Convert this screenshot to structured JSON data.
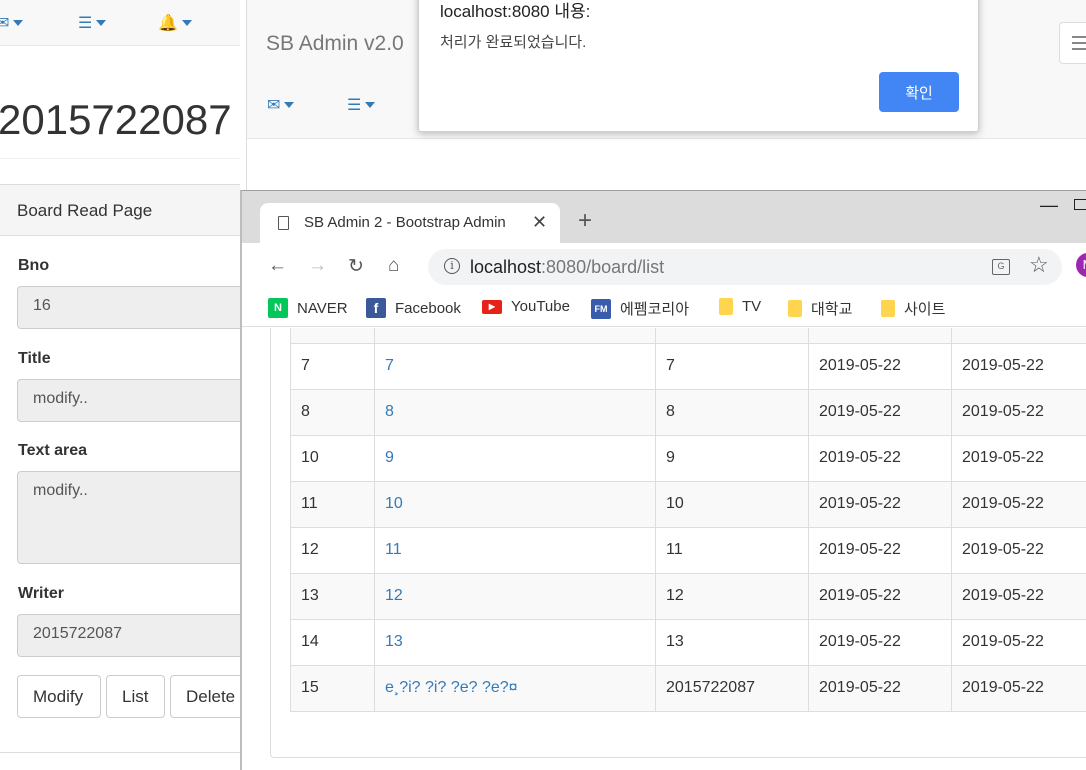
{
  "left_window": {
    "big_number": "2015722087",
    "panel_heading": "Board Read Page",
    "fields": [
      {
        "label": "Bno",
        "value": "16"
      },
      {
        "label": "Title",
        "value": "modify.."
      },
      {
        "label": "Text area",
        "value": "modify.."
      },
      {
        "label": "Writer",
        "value": "2015722087"
      }
    ],
    "buttons": [
      "Modify",
      "List",
      "Delete"
    ]
  },
  "middle_window": {
    "brand": "SB Admin v2.0"
  },
  "alert": {
    "title": "localhost:8080 내용:",
    "message": "처리가 완료되었습니다.",
    "ok_label": "확인"
  },
  "browser": {
    "tab_title": "SB Admin 2 - Bootstrap Admin",
    "url_host": "localhost",
    "url_rest": ":8080/board/list",
    "profile_initial": "M",
    "bookmarks": [
      {
        "label": "NAVER",
        "icon": "naver-icon",
        "color": "#03c75a",
        "glyph": "N"
      },
      {
        "label": "Facebook",
        "icon": "facebook-icon",
        "color": "#3b5998",
        "glyph": "f"
      },
      {
        "label": "YouTube",
        "icon": "youtube-icon",
        "color": "#e62117",
        "glyph": "▶"
      },
      {
        "label": "에펨코리아",
        "icon": "fmkorea-icon",
        "color": "#3a5cad",
        "glyph": "FM"
      },
      {
        "label": "TV",
        "icon": "folder-icon"
      },
      {
        "label": "대학교",
        "icon": "folder-icon"
      },
      {
        "label": "사이트",
        "icon": "folder-icon"
      }
    ]
  },
  "board_table": {
    "rows": [
      {
        "bno": "7",
        "title": "7",
        "writer": "7",
        "regdate": "2019-05-22",
        "updatedate": "2019-05-22"
      },
      {
        "bno": "8",
        "title": "8",
        "writer": "8",
        "regdate": "2019-05-22",
        "updatedate": "2019-05-22"
      },
      {
        "bno": "10",
        "title": "9",
        "writer": "9",
        "regdate": "2019-05-22",
        "updatedate": "2019-05-22"
      },
      {
        "bno": "11",
        "title": "10",
        "writer": "10",
        "regdate": "2019-05-22",
        "updatedate": "2019-05-22"
      },
      {
        "bno": "12",
        "title": "11",
        "writer": "11",
        "regdate": "2019-05-22",
        "updatedate": "2019-05-22"
      },
      {
        "bno": "13",
        "title": "12",
        "writer": "12",
        "regdate": "2019-05-22",
        "updatedate": "2019-05-22"
      },
      {
        "bno": "14",
        "title": "13",
        "writer": "13",
        "regdate": "2019-05-22",
        "updatedate": "2019-05-22"
      },
      {
        "bno": "15",
        "title": "e¸?i? ?i? ?e? ?e?¤",
        "writer": "2015722087",
        "regdate": "2019-05-22",
        "updatedate": "2019-05-22"
      }
    ]
  },
  "colors": {
    "link": "#337ab7",
    "alert_button": "#4285f4"
  }
}
